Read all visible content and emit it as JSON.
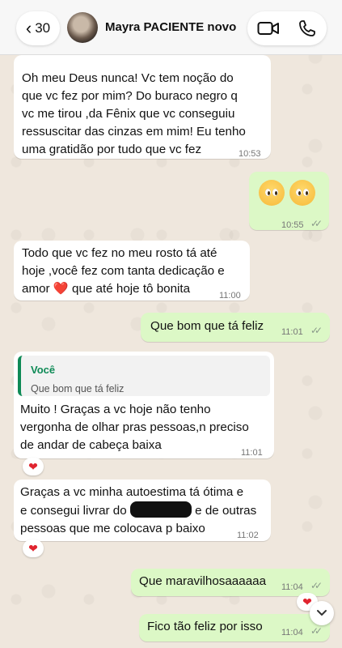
{
  "header": {
    "back_count": "30",
    "back_chevron": "‹",
    "contact_name": "Mayra PACIENTE novo",
    "icons": [
      "video-call-icon",
      "phone-call-icon"
    ]
  },
  "messages": [
    {
      "id": "m1",
      "direction": "in",
      "lines": [
        "Oh meu Deus nunca! Vc tem noção do",
        "que vc fez por mim? Do buraco negro q",
        "vc me tirou ,da Fênix que vc conseguiu",
        "ressuscitar das cinzas em mim! Eu tenho",
        "uma gratidão por tudo que vc fez"
      ],
      "time": "10:53"
    },
    {
      "id": "m2",
      "direction": "out",
      "emojis": [
        "pleading-face",
        "pleading-face-tear"
      ],
      "time": "10:55",
      "status": "read"
    },
    {
      "id": "m3",
      "direction": "in",
      "lines": [
        "Todo que vc fez no meu rosto tá até",
        "hoje ,você fez com tanta dedicação e"
      ],
      "line3_before": "amor",
      "line3_emoji": "❤️",
      "line3_after": "que até hoje tô bonita",
      "time": "11:00"
    },
    {
      "id": "m4",
      "direction": "out",
      "text": "Que bom que tá feliz",
      "time": "11:01",
      "status": "read"
    },
    {
      "id": "m5",
      "direction": "in",
      "quote_author": "Você",
      "quote_text": "Que bom que tá feliz",
      "lines": [
        "Muito ! Graças a vc hoje não tenho",
        "vergonha de olhar pras pessoas,n preciso",
        "de andar de cabeça baixa"
      ],
      "time": "11:01",
      "reaction": "❤"
    },
    {
      "id": "m6",
      "direction": "in",
      "line1": "Graças a vc minha autoestima tá ótima e",
      "line2_before": "e consegui livrar do",
      "line2_after": "e de outras",
      "line3": "pessoas que me colocava p baixo",
      "time": "11:02",
      "reaction": "❤"
    },
    {
      "id": "m7",
      "direction": "out",
      "text": "Que maravilhosaaaaaa",
      "time": "11:04",
      "status": "read",
      "reaction": "❤"
    },
    {
      "id": "m8",
      "direction": "out",
      "text": "Fico tão feliz por isso",
      "time": "11:04",
      "status": "read"
    }
  ],
  "scroll_down_icon": "chevron-down-icon",
  "colors": {
    "incoming": "#ffffff",
    "outgoing": "#dcf8c6",
    "accent": "#0e8a56",
    "heart": "#e0242f",
    "background": "#efe7de"
  }
}
